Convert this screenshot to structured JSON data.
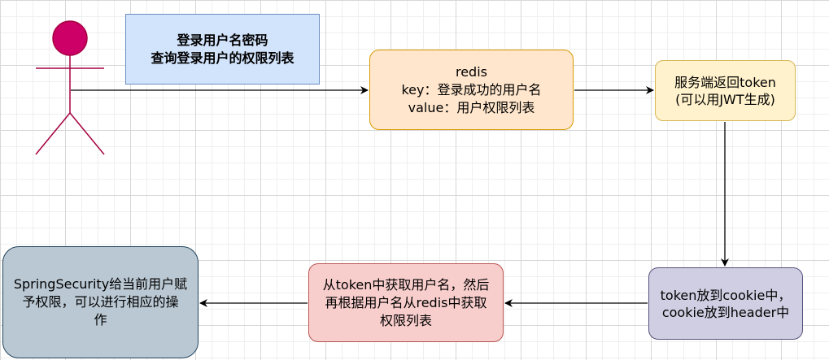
{
  "nodes": {
    "note": "登录用户名密码\n查询登录用户的权限列表",
    "redis": "redis\nkey：登录成功的用户名\nvalue：用户权限列表",
    "token": "服务端返回token\n(可以用JWT生成)",
    "cookie": "token放到cookie中，\ncookie放到header中",
    "parse": "从token中获取用户名，然后\n再根据用户名从redis中获取\n权限列表",
    "security": "SpringSecurity给当前用户赋\n予权限，可以进行相应的操\n作"
  },
  "colors": {
    "actor_head": "#cc0066",
    "actor_stroke": "#a50040",
    "arrow": "#000000",
    "note_fill": "#d2e3fc",
    "redis_fill": "#ffe6cc",
    "token_fill": "#fff2cc",
    "cookie_fill": "#d0cee2",
    "parse_fill": "#f8cecc",
    "security_fill": "#bac8d3"
  },
  "icons": {
    "actor": "stick-figure-actor-icon"
  }
}
